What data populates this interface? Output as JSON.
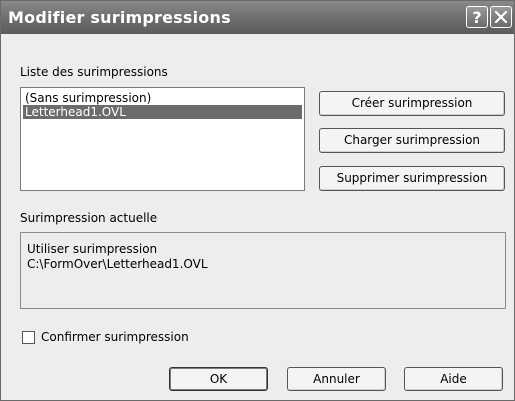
{
  "window": {
    "title": "Modifier surimpressions",
    "help_glyph": "?",
    "close_icon": "close-icon"
  },
  "overlay_list": {
    "label": "Liste des surimpressions",
    "items": [
      {
        "label": "(Sans surimpression)",
        "selected": false
      },
      {
        "label": "Letterhead1.OVL",
        "selected": true
      }
    ]
  },
  "actions": {
    "create": "Créer surimpression",
    "load": "Charger surimpression",
    "delete": "Supprimer surimpression"
  },
  "current_overlay": {
    "label": "Surimpression actuelle",
    "line1": "Utiliser surimpression",
    "line2": "C:\\FormOver\\Letterhead1.OVL"
  },
  "confirm": {
    "label": "Confirmer surimpression",
    "checked": false
  },
  "footer": {
    "ok": "OK",
    "cancel": "Annuler",
    "help": "Aide"
  },
  "colors": {
    "titlebar": "#6e6e6e",
    "selection": "#6b6b6b",
    "dialog_bg": "#ededed"
  }
}
